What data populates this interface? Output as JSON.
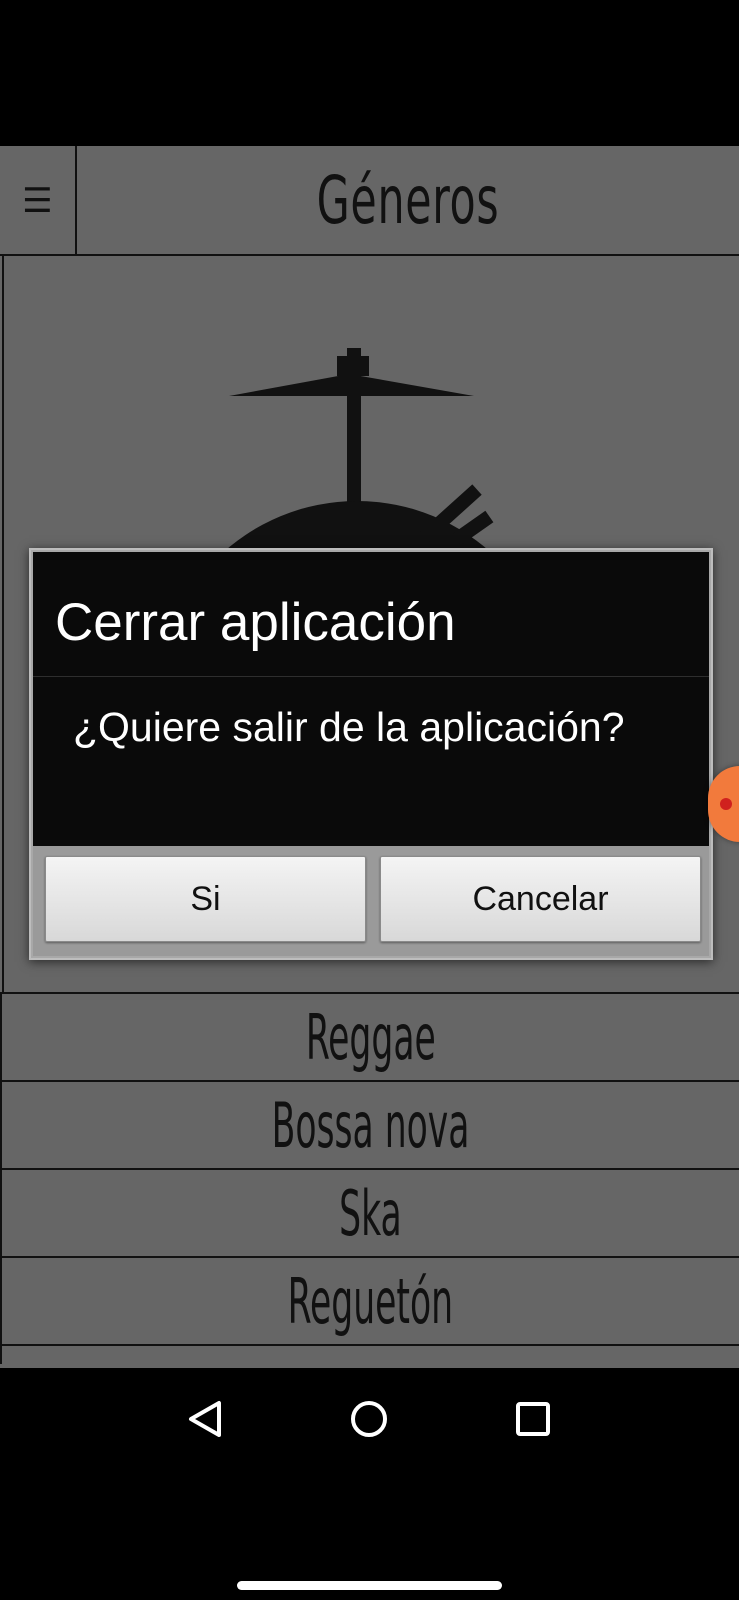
{
  "header": {
    "menu_icon": "☰",
    "title": "Géneros"
  },
  "hero": {
    "icon": "drum-kit-icon"
  },
  "genres": [
    {
      "label": "Reggae"
    },
    {
      "label": "Bossa nova"
    },
    {
      "label": "Ska"
    },
    {
      "label": "Reguetón"
    },
    {
      "label": ""
    }
  ],
  "dialog": {
    "title": "Cerrar aplicación",
    "message": "¿Quiere salir de la aplicación?",
    "confirm_label": "Si",
    "cancel_label": "Cancelar"
  },
  "colors": {
    "app_background": "#666666",
    "dialog_background": "#0a0a0a",
    "bubble": "#f27a3c"
  }
}
